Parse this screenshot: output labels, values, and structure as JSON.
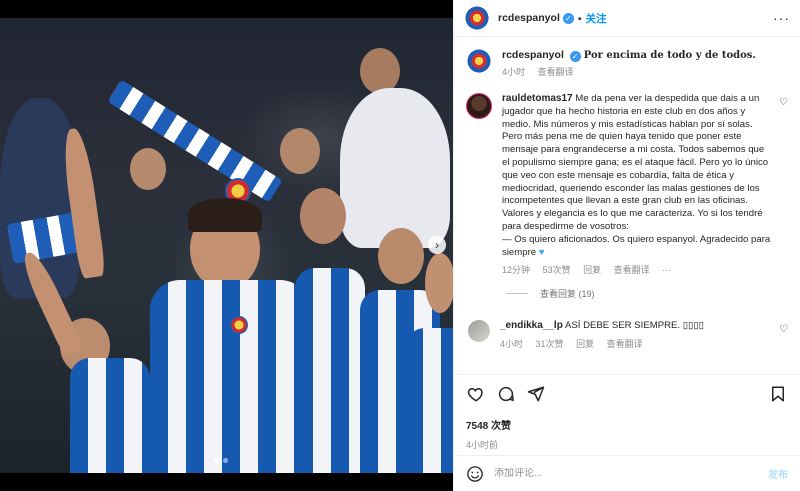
{
  "post": {
    "username": "rcdespanyol",
    "follow_label": "关注",
    "more_icon": "more-horizontal-icon",
    "caption": {
      "username": "rcdespanyol",
      "text": "Por encima de todo y de todos.",
      "time": "4小时",
      "translate_label": "查看翻译"
    },
    "comments": [
      {
        "username": "rauldetomas17",
        "text": "Me da pena ver la despedida que dais a un jugador que ha hecho historia en este club en dos años y medio. Mis números y mis estadísticas hablan por sí solas. Pero más pena me de quien haya tenido que poner este mensaje para engrandecerse a mi costa. Todos sabemos que el populismo siempre gana; es el ataque fácil. Pero yo lo único que veo con este mensaje es cobardía, falta de ética y mediocridad, queriendo esconder las malas gestiones de los incompetentes que llevan a este gran club en las oficinas. Valores y elegancia es lo que me caracteriza. Yo si los tendré para despedirme de vosotros:",
        "text2": "— Os quiero aficionados. Os quiero espanyol. Agradecido para siempre",
        "time": "12分钟",
        "likes": "53次赞",
        "reply_label": "回复",
        "translate_label": "查看翻译",
        "more": "···",
        "view_replies": "查看回复 (19)"
      },
      {
        "username": "_endikka__lp",
        "text": "ASÍ DEBE SER SIEMPRE. ▯▯▯▯",
        "time": "4小时",
        "likes": "31次赞",
        "reply_label": "回复",
        "translate_label": "查看翻译"
      }
    ],
    "likes_count": "7548 次赞",
    "posted_time": "4小时前",
    "add_comment_placeholder": "添加评论...",
    "post_label": "发布"
  },
  "colors": {
    "link_blue": "#0095f6",
    "verified_blue": "#3897f0",
    "muted_gray": "#8e8e8e",
    "espanyol_blue": "#1e5db8"
  }
}
